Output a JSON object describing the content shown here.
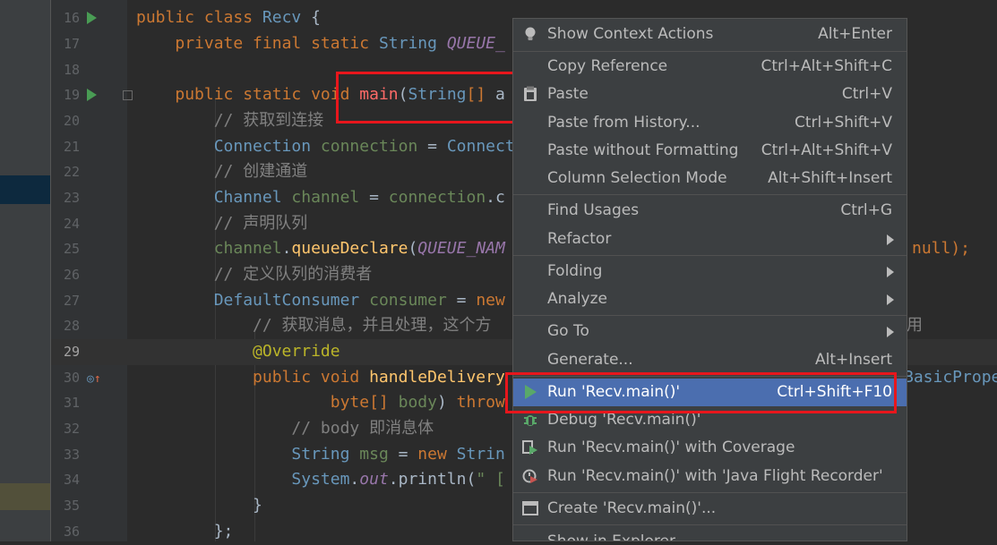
{
  "editor": {
    "lines": [
      {
        "n": "16",
        "text": "public class Recv {"
      },
      {
        "n": "17",
        "text": "    private final static String QUEUE_"
      },
      {
        "n": "18",
        "text": ""
      },
      {
        "n": "19",
        "text": "    public static void main(String[] a"
      },
      {
        "n": "20",
        "text": "        // 获取到连接"
      },
      {
        "n": "21",
        "text": "        Connection connection = Connect"
      },
      {
        "n": "22",
        "text": "        // 创建通道"
      },
      {
        "n": "23",
        "text": "        Channel channel = connection.c"
      },
      {
        "n": "24",
        "text": "        // 声明队列"
      },
      {
        "n": "25",
        "text": "        channel.queueDeclare(QUEUE_NAM"
      },
      {
        "n": "26",
        "text": "        // 定义队列的消费者"
      },
      {
        "n": "27",
        "text": "        DefaultConsumer consumer = new"
      },
      {
        "n": "28",
        "text": "            // 获取消息，并且处理，这个方"
      },
      {
        "n": "29",
        "text": "            @Override"
      },
      {
        "n": "30",
        "text": "            public void handleDelivery"
      },
      {
        "n": "31",
        "text": "                    byte[] body) throw"
      },
      {
        "n": "32",
        "text": "                // body 即消息体"
      },
      {
        "n": "33",
        "text": "                String msg = new Strin"
      },
      {
        "n": "34",
        "text": "                System.out.println(\" ["
      },
      {
        "n": "35",
        "text": "            }"
      },
      {
        "n": "36",
        "text": "        };"
      }
    ],
    "overflow_25": "null);",
    "overflow_28": "用",
    "overflow_30": "BasicPrope"
  },
  "context_menu": {
    "items": [
      {
        "id": "show-context-actions",
        "label": "Show Context Actions",
        "shortcut": "Alt+Enter",
        "icon": "bulb-icon"
      },
      {
        "id": "copy-reference",
        "label": "Copy Reference",
        "shortcut": "Ctrl+Alt+Shift+C"
      },
      {
        "id": "paste",
        "label": "Paste",
        "shortcut": "Ctrl+V",
        "icon": "clipboard-icon"
      },
      {
        "id": "paste-from-history",
        "label": "Paste from History...",
        "shortcut": "Ctrl+Shift+V"
      },
      {
        "id": "paste-without-formatting",
        "label": "Paste without Formatting",
        "shortcut": "Ctrl+Alt+Shift+V"
      },
      {
        "id": "column-selection-mode",
        "label": "Column Selection Mode",
        "shortcut": "Alt+Shift+Insert"
      },
      {
        "id": "find-usages",
        "label": "Find Usages",
        "shortcut": "Ctrl+G"
      },
      {
        "id": "refactor",
        "label": "Refactor",
        "submenu": true
      },
      {
        "id": "folding",
        "label": "Folding",
        "submenu": true
      },
      {
        "id": "analyze",
        "label": "Analyze",
        "submenu": true
      },
      {
        "id": "go-to",
        "label": "Go To",
        "submenu": true
      },
      {
        "id": "generate",
        "label": "Generate...",
        "shortcut": "Alt+Insert"
      },
      {
        "id": "run",
        "label": "Run 'Recv.main()'",
        "shortcut": "Ctrl+Shift+F10",
        "icon": "run-icon",
        "highlighted": true
      },
      {
        "id": "debug",
        "label": "Debug 'Recv.main()'",
        "icon": "debug-icon"
      },
      {
        "id": "run-coverage",
        "label": "Run 'Recv.main()' with Coverage",
        "icon": "coverage-icon"
      },
      {
        "id": "run-jfr",
        "label": "Run 'Recv.main()' with 'Java Flight Recorder'",
        "icon": "jfr-icon"
      },
      {
        "id": "create",
        "label": "Create 'Recv.main()'...",
        "icon": "create-config-icon"
      },
      {
        "id": "show-in-explorer",
        "label": "Show in Explorer"
      }
    ]
  },
  "colors": {
    "highlight": "#4b6eaf",
    "annotation_red": "#e8161c"
  }
}
